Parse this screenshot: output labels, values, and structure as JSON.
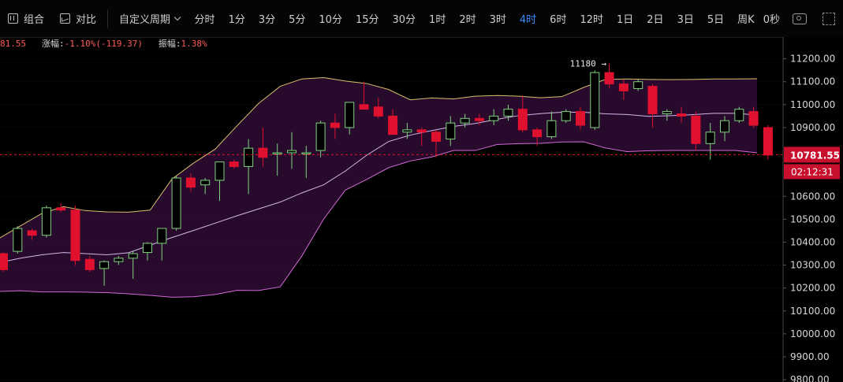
{
  "toolbar": {
    "combine_label": "组合",
    "compare_label": "对比",
    "custom_period_label": "自定义周期",
    "periods": [
      "分时",
      "1分",
      "3分",
      "5分",
      "10分",
      "15分",
      "30分",
      "1时",
      "2时",
      "3时",
      "4时",
      "6时",
      "12时",
      "1日",
      "2日",
      "3日",
      "5日",
      "周K"
    ],
    "active_period": "4时",
    "latency": "0秒",
    "camera_icon": "camera-icon",
    "fullscreen_icon": "fullscreen-icon"
  },
  "infobar": {
    "price_fragment": "81.55",
    "change_label": "涨幅:",
    "change_value": "-1.10%(-119.37)",
    "amplitude_label": "振幅:",
    "amplitude_value": "1.38%"
  },
  "colors": {
    "up": "#7fd17f",
    "down": "#e0102f",
    "band_fill": "#2a0b2f",
    "upper_band": "#d6c06a",
    "mid_band": "#d2b8e6",
    "lower_band": "#d06ad6"
  },
  "chart_data": {
    "type": "candlestick",
    "y_ticks": [
      "11200.00",
      "11100.00",
      "11000.00",
      "10900.00",
      "10600.00",
      "10500.00",
      "10400.00",
      "10300.00",
      "10200.00",
      "10100.00",
      "10000.00",
      "9900.00",
      "9800.00"
    ],
    "ylim": [
      9790,
      11240
    ],
    "current_price": "10781.55",
    "countdown": "02:12:31",
    "high_marker": "11180 →",
    "candles": [
      [
        10350,
        10355,
        10270,
        10280
      ],
      [
        10360,
        10470,
        10350,
        10460
      ],
      [
        10450,
        10460,
        10410,
        10430
      ],
      [
        10430,
        10560,
        10420,
        10550
      ],
      [
        10550,
        10570,
        10530,
        10540
      ],
      [
        10540,
        10560,
        10300,
        10320
      ],
      [
        10325,
        10340,
        10270,
        10280
      ],
      [
        10285,
        10320,
        10210,
        10315
      ],
      [
        10315,
        10340,
        10300,
        10330
      ],
      [
        10330,
        10360,
        10240,
        10350
      ],
      [
        10355,
        10400,
        10320,
        10395
      ],
      [
        10395,
        10460,
        10320,
        10460
      ],
      [
        10460,
        10690,
        10450,
        10680
      ],
      [
        10680,
        10700,
        10620,
        10640
      ],
      [
        10650,
        10680,
        10610,
        10670
      ],
      [
        10670,
        10740,
        10580,
        10750
      ],
      [
        10750,
        10760,
        10720,
        10730
      ],
      [
        10730,
        10850,
        10610,
        10810
      ],
      [
        10810,
        10900,
        10730,
        10770
      ],
      [
        10790,
        10830,
        10690,
        10790
      ],
      [
        10790,
        10880,
        10720,
        10800
      ],
      [
        10790,
        10820,
        10680,
        10790
      ],
      [
        10800,
        10930,
        10770,
        10920
      ],
      [
        10920,
        10960,
        10850,
        10900
      ],
      [
        10900,
        11010,
        10870,
        11010
      ],
      [
        11000,
        11100,
        10990,
        10980
      ],
      [
        10990,
        11030,
        10940,
        10950
      ],
      [
        10950,
        10980,
        10870,
        10870
      ],
      [
        10880,
        10920,
        10850,
        10890
      ],
      [
        10890,
        10900,
        10820,
        10880
      ],
      [
        10880,
        10890,
        10770,
        10840
      ],
      [
        10850,
        10950,
        10820,
        10920
      ],
      [
        10920,
        10960,
        10900,
        10940
      ],
      [
        10940,
        10960,
        10910,
        10930
      ],
      [
        10930,
        10980,
        10910,
        10950
      ],
      [
        10950,
        11000,
        10930,
        10980
      ],
      [
        10980,
        11040,
        10880,
        10890
      ],
      [
        10890,
        10900,
        10820,
        10860
      ],
      [
        10860,
        10970,
        10850,
        10930
      ],
      [
        10930,
        10980,
        10920,
        10970
      ],
      [
        10970,
        10990,
        10890,
        10910
      ],
      [
        10900,
        11150,
        10890,
        11140
      ],
      [
        11140,
        11180,
        11070,
        11090
      ],
      [
        11090,
        11110,
        11020,
        11060
      ],
      [
        11070,
        11110,
        11060,
        11100
      ],
      [
        11080,
        11090,
        10900,
        10960
      ],
      [
        10960,
        10980,
        10930,
        10970
      ],
      [
        10960,
        10990,
        10920,
        10950
      ],
      [
        10950,
        10970,
        10800,
        10830
      ],
      [
        10830,
        10920,
        10760,
        10880
      ],
      [
        10880,
        10950,
        10840,
        10930
      ],
      [
        10930,
        10990,
        10920,
        10980
      ],
      [
        10970,
        10990,
        10900,
        10910
      ],
      [
        10900,
        10910,
        10760,
        10780
      ]
    ],
    "bands": {
      "upper": [
        10415,
        10470,
        10525,
        10555,
        10538,
        10532,
        10531,
        10540,
        10675,
        10745,
        10806,
        10907,
        11005,
        11080,
        11112,
        11118,
        11103,
        11092,
        11066,
        11021,
        11029,
        11025,
        11037,
        11040,
        11037,
        11030,
        11035,
        11075,
        11110,
        11112,
        11110,
        11109,
        11110,
        11112,
        11112,
        11113
      ],
      "mid": [
        10310,
        10330,
        10345,
        10355,
        10350,
        10345,
        10354,
        10387,
        10420,
        10451,
        10483,
        10515,
        10545,
        10575,
        10615,
        10650,
        10710,
        10780,
        10839,
        10867,
        10887,
        10905,
        10918,
        10936,
        10952,
        10961,
        10967,
        10967,
        10960,
        10957,
        10949,
        10952,
        10956,
        10962,
        10962,
        10955
      ],
      "lower": [
        10185,
        10188,
        10183,
        10183,
        10182,
        10180,
        10175,
        10168,
        10160,
        10162,
        10172,
        10190,
        10189,
        10205,
        10340,
        10500,
        10627,
        10674,
        10725,
        10754,
        10772,
        10800,
        10800,
        10826,
        10830,
        10831,
        10837,
        10838,
        10811,
        10795,
        10799,
        10800,
        10800,
        10800,
        10800,
        10790
      ]
    }
  }
}
